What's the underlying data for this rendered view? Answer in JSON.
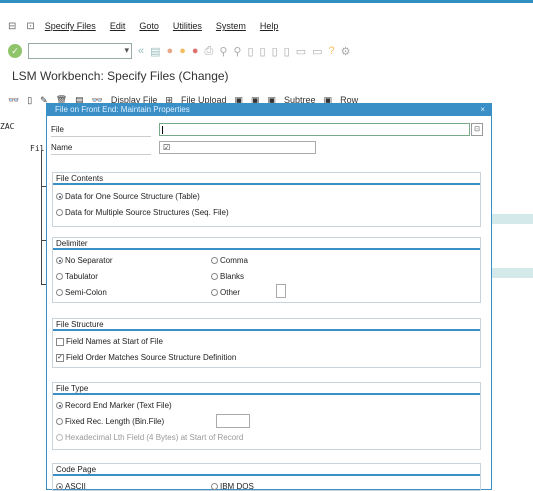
{
  "menu": {
    "items": [
      "Specify Files",
      "Edit",
      "Goto",
      "Utilities",
      "System",
      "Help"
    ]
  },
  "screen_title": "LSM Workbench: Specify Files (Change)",
  "app_toolbar": {
    "display_file": "Display File",
    "file_upload": "File Upload",
    "subtree": "Subtree",
    "row": "Row"
  },
  "background": {
    "left_text_1": "ZAC",
    "left_text_2": "Fil"
  },
  "dialog": {
    "title": "File on Front End: Maintain Properties",
    "file_label": "File",
    "file_value": "",
    "name_label": "Name",
    "name_value": "☑",
    "file_contents": {
      "header": "File Contents",
      "options": [
        "Data for One Source Structure (Table)",
        "Data for Multiple Source Structures (Seq. File)"
      ],
      "selected": 0
    },
    "delimiter": {
      "header": "Delimiter",
      "left": [
        "No Separator",
        "Tabulator",
        "Semi-Colon"
      ],
      "right": [
        "Comma",
        "Blanks",
        "Other"
      ],
      "selected": "No Separator"
    },
    "file_structure": {
      "header": "File Structure",
      "options": [
        {
          "label": "Field Names at Start of File",
          "checked": false
        },
        {
          "label": "Field Order Matches Source Structure Definition",
          "checked": true
        }
      ]
    },
    "file_type": {
      "header": "File Type",
      "options": [
        "Record End Marker (Text File)",
        "Fixed Rec. Length (Bin.File)",
        "Hexadecimal Lth Field (4 Bytes) at Start of Record"
      ],
      "selected": 0
    },
    "code_page": {
      "header": "Code Page",
      "left": "ASCII",
      "right": "IBM DOS",
      "selected": "ASCII"
    }
  }
}
